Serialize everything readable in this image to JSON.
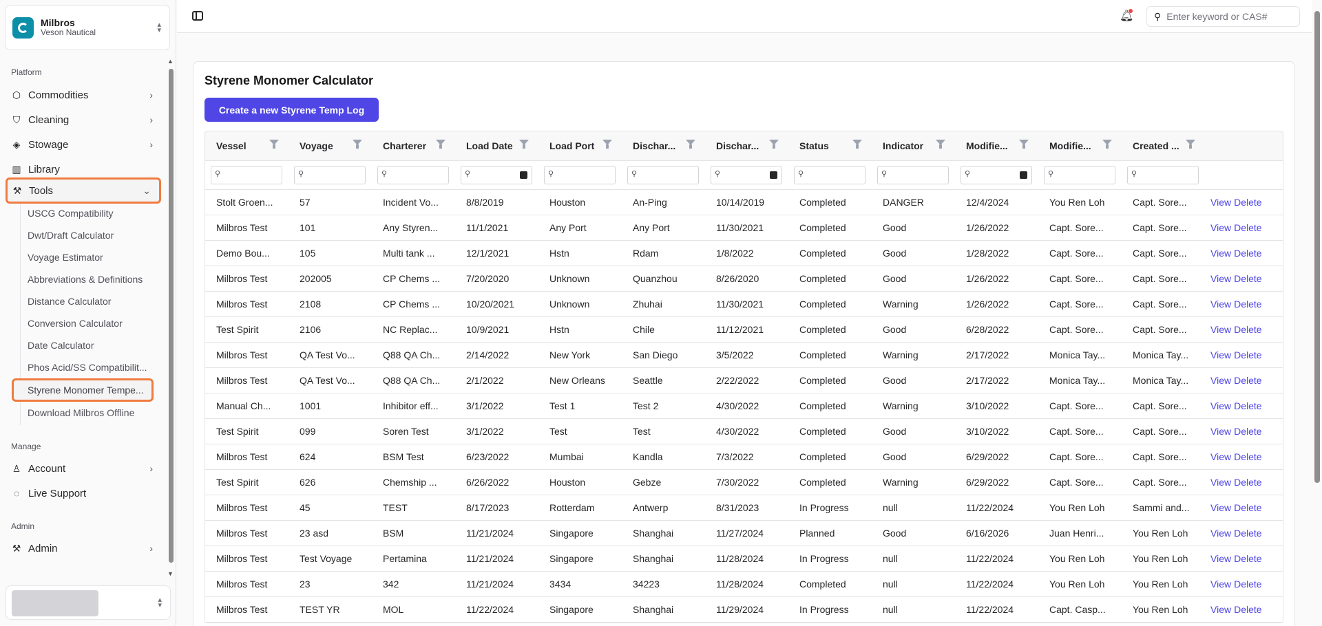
{
  "org": {
    "name": "Milbros",
    "subtitle": "Veson Nautical"
  },
  "sidebar": {
    "platform_label": "Platform",
    "platform_items": [
      {
        "label": "Commodities",
        "icon": "box-icon"
      },
      {
        "label": "Cleaning",
        "icon": "shield-check-icon"
      },
      {
        "label": "Stowage",
        "icon": "layers-icon"
      },
      {
        "label": "Library",
        "icon": "library-icon"
      },
      {
        "label": "Tools",
        "icon": "wrench-icon"
      }
    ],
    "tools_subitems": [
      "USCG Compatibility",
      "Dwt/Draft Calculator",
      "Voyage Estimator",
      "Abbreviations & Definitions",
      "Distance Calculator",
      "Conversion Calculator",
      "Date Calculator",
      "Phos Acid/SS Compatibilit...",
      "Styrene Monomer Tempe...",
      "Download Milbros Offline"
    ],
    "manage_label": "Manage",
    "manage_items": [
      {
        "label": "Account",
        "icon": "user-icon"
      },
      {
        "label": "Live Support",
        "icon": "support-icon"
      }
    ],
    "admin_label": "Admin",
    "admin_items": [
      {
        "label": "Admin",
        "icon": "wrench-icon"
      }
    ]
  },
  "header": {
    "search_placeholder": "Enter keyword or CAS#"
  },
  "page": {
    "title": "Styrene Monomer Calculator",
    "create_button": "Create a new Styrene Temp Log"
  },
  "table": {
    "columns": [
      "Vessel",
      "Voyage",
      "Charterer",
      "Load Date",
      "Load Port",
      "Dischar...",
      "Dischar...",
      "Status",
      "Indicator",
      "Modifie...",
      "Modifie...",
      "Created ..."
    ],
    "date_filter_columns": [
      3,
      6,
      9
    ],
    "view_label": "View",
    "delete_label": "Delete",
    "rows": [
      [
        "Stolt Groen...",
        "57",
        "Incident Vo...",
        "8/8/2019",
        "Houston",
        "An-Ping",
        "10/14/2019",
        "Completed",
        "DANGER",
        "12/4/2024",
        "You Ren Loh",
        "Capt. Sore..."
      ],
      [
        "Milbros Test",
        "101",
        "Any Styren...",
        "11/1/2021",
        "Any Port",
        "Any Port",
        "11/30/2021",
        "Completed",
        "Good",
        "1/26/2022",
        "Capt. Sore...",
        "Capt. Sore..."
      ],
      [
        "Demo Bou...",
        "105",
        "Multi tank ...",
        "12/1/2021",
        "Hstn",
        "Rdam",
        "1/8/2022",
        "Completed",
        "Good",
        "1/28/2022",
        "Capt. Sore...",
        "Capt. Sore..."
      ],
      [
        "Milbros Test",
        "202005",
        "CP Chems ...",
        "7/20/2020",
        "Unknown",
        "Quanzhou",
        "8/26/2020",
        "Completed",
        "Good",
        "1/26/2022",
        "Capt. Sore...",
        "Capt. Sore..."
      ],
      [
        "Milbros Test",
        "2108",
        "CP Chems ...",
        "10/20/2021",
        "Unknown",
        "Zhuhai",
        "11/30/2021",
        "Completed",
        "Warning",
        "1/26/2022",
        "Capt. Sore...",
        "Capt. Sore..."
      ],
      [
        "Test Spirit",
        "2106",
        "NC Replac...",
        "10/9/2021",
        "Hstn",
        "Chile",
        "11/12/2021",
        "Completed",
        "Good",
        "6/28/2022",
        "Capt. Sore...",
        "Capt. Sore..."
      ],
      [
        "Milbros Test",
        "QA Test Vo...",
        "Q88 QA Ch...",
        "2/14/2022",
        "New York",
        "San Diego",
        "3/5/2022",
        "Completed",
        "Warning",
        "2/17/2022",
        "Monica Tay...",
        "Monica Tay..."
      ],
      [
        "Milbros Test",
        "QA Test Vo...",
        "Q88 QA Ch...",
        "2/1/2022",
        "New Orleans",
        "Seattle",
        "2/22/2022",
        "Completed",
        "Good",
        "2/17/2022",
        "Monica Tay...",
        "Monica Tay..."
      ],
      [
        "Manual Ch...",
        "1001",
        "Inhibitor eff...",
        "3/1/2022",
        "Test 1",
        "Test 2",
        "4/30/2022",
        "Completed",
        "Warning",
        "3/10/2022",
        "Capt. Sore...",
        "Capt. Sore..."
      ],
      [
        "Test Spirit",
        "099",
        "Soren Test",
        "3/1/2022",
        "Test",
        "Test",
        "4/30/2022",
        "Completed",
        "Good",
        "3/10/2022",
        "Capt. Sore...",
        "Capt. Sore..."
      ],
      [
        "Milbros Test",
        "624",
        "BSM Test",
        "6/23/2022",
        "Mumbai",
        "Kandla",
        "7/3/2022",
        "Completed",
        "Good",
        "6/29/2022",
        "Capt. Sore...",
        "Capt. Sore..."
      ],
      [
        "Test Spirit",
        "626",
        "Chemship ...",
        "6/26/2022",
        "Houston",
        "Gebze",
        "7/30/2022",
        "Completed",
        "Warning",
        "6/29/2022",
        "Capt. Sore...",
        "Capt. Sore..."
      ],
      [
        "Milbros Test",
        "45",
        "TEST",
        "8/17/2023",
        "Rotterdam",
        "Antwerp",
        "8/31/2023",
        "In Progress",
        "null",
        "11/22/2024",
        "You Ren Loh",
        "Sammi and..."
      ],
      [
        "Milbros Test",
        "23 asd",
        "BSM",
        "11/21/2024",
        "Singapore",
        "Shanghai",
        "11/27/2024",
        "Planned",
        "Good",
        "6/16/2026",
        "Juan Henri...",
        "You Ren Loh"
      ],
      [
        "Milbros Test",
        "Test Voyage",
        "Pertamina",
        "11/21/2024",
        "Singapore",
        "Shanghai",
        "11/28/2024",
        "In Progress",
        "null",
        "11/22/2024",
        "You Ren Loh",
        "You Ren Loh"
      ],
      [
        "Milbros Test",
        "23",
        "342",
        "11/21/2024",
        "3434",
        "34223",
        "11/28/2024",
        "Completed",
        "null",
        "11/22/2024",
        "You Ren Loh",
        "You Ren Loh"
      ],
      [
        "Milbros Test",
        "TEST YR",
        "MOL",
        "11/22/2024",
        "Singapore",
        "Shanghai",
        "11/29/2024",
        "In Progress",
        "null",
        "11/22/2024",
        "Capt. Casp...",
        "You Ren Loh"
      ]
    ]
  }
}
